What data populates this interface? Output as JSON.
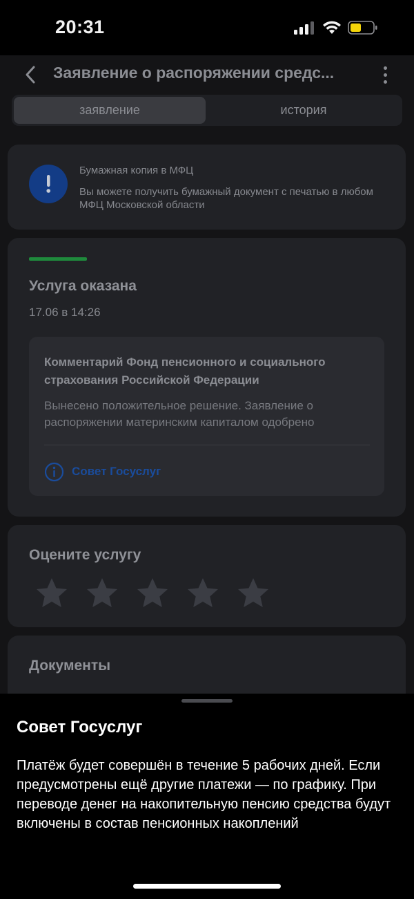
{
  "status_bar": {
    "time": "20:31"
  },
  "header": {
    "title": "Заявление о распоряжении средс..."
  },
  "tabs": [
    {
      "label": "заявление",
      "active": true
    },
    {
      "label": "история",
      "active": false
    }
  ],
  "mfc_card": {
    "title": "Бумажная копия в МФЦ",
    "text": "Вы можете получить бумажный документ с печатью в любом МФЦ Московской области"
  },
  "status_card": {
    "progress_color": "#1f8a3c",
    "title": "Услуга оказана",
    "date": "17.06 в 14:26",
    "comment_title": "Комментарий Фонд пенсионного и социального страхования Российской Федерации",
    "comment_text": "Вынесено положительное решение. Заявление о распоряжении материнским капиталом одобрено",
    "tip_link": "Совет Госуслуг"
  },
  "rating_card": {
    "title": "Оцените услугу",
    "stars_total": 5,
    "stars_selected": 0
  },
  "documents_card": {
    "title": "Документы"
  },
  "bottom_sheet": {
    "title": "Совет Госуслуг",
    "text": "Платёж будет совершён в течение 5 рабочих дней. Если предусмотрены ещё другие платежи — по графику. При переводе денег на накопительную пенсию средства будут включены в состав пенсионных накоплений"
  },
  "colors": {
    "accent_blue": "#1a4c9c",
    "info_badge": "#133c86",
    "battery_fill": "#f5d60a"
  },
  "icons": {
    "back": "chevron-left-icon",
    "more": "more-vertical-icon",
    "mfc_badge": "exclamation-icon",
    "tip": "info-circle-icon",
    "rating": "star-icon"
  }
}
